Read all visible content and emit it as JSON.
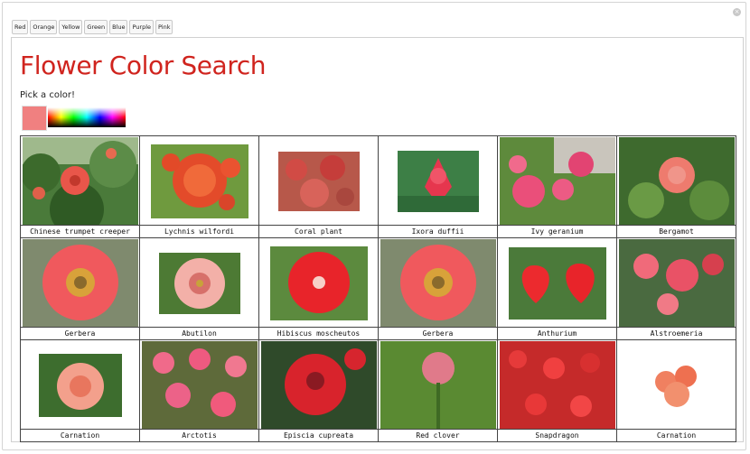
{
  "color_tabs": [
    "Red",
    "Orange",
    "Yellow",
    "Green",
    "Blue",
    "Purple",
    "Pink"
  ],
  "close_label": "×",
  "title": "Flower Color Search",
  "pick_label": "Pick a color!",
  "selected_color": "#f08080",
  "accent_color": "#d0241e",
  "flowers": [
    {
      "name": "Chinese trumpet creeper"
    },
    {
      "name": "Lychnis wilfordi"
    },
    {
      "name": "Coral plant"
    },
    {
      "name": "Ixora duffii"
    },
    {
      "name": "Ivy geranium"
    },
    {
      "name": "Bergamot"
    },
    {
      "name": "Gerbera"
    },
    {
      "name": "Abutilon"
    },
    {
      "name": "Hibiscus moscheutos"
    },
    {
      "name": "Gerbera"
    },
    {
      "name": "Anthurium"
    },
    {
      "name": "Alstroemeria"
    },
    {
      "name": "Carnation"
    },
    {
      "name": "Arctotis"
    },
    {
      "name": "Episcia cupreata"
    },
    {
      "name": "Red clover"
    },
    {
      "name": "Snapdragon"
    },
    {
      "name": "Carnation"
    }
  ]
}
